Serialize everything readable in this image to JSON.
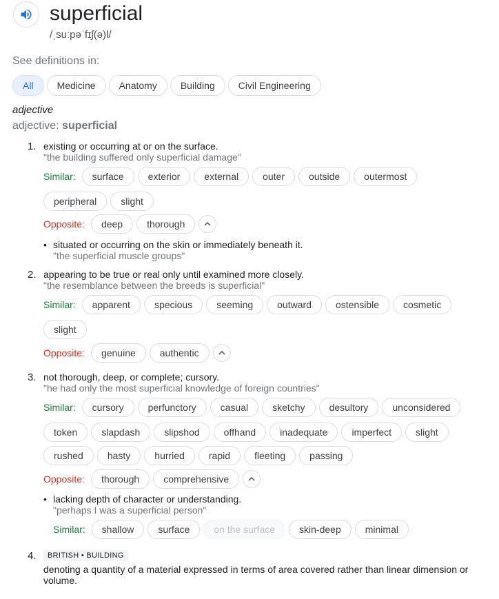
{
  "entry": {
    "word": "superficial",
    "phonetic": "/ˌsuːpəˈfɪʃ(ə)l/"
  },
  "see_definitions": {
    "label": "See definitions in:",
    "tabs": [
      "All",
      "Medicine",
      "Anatomy",
      "Building",
      "Civil Engineering"
    ]
  },
  "pos": {
    "type": "adjective",
    "line_prefix": "adjective: ",
    "line_word": "superficial"
  },
  "labels": {
    "similar": "Similar:",
    "opposite": "Opposite:"
  },
  "senses": [
    {
      "num": "1.",
      "def": "existing or occurring at or on the surface.",
      "example": "\"the building suffered only superficial damage\"",
      "similar_row1": [
        "surface",
        "exterior",
        "external",
        "outer",
        "outside",
        "outermost"
      ],
      "similar_row2": [
        "peripheral",
        "slight"
      ],
      "opposite": [
        "deep",
        "thorough"
      ],
      "sub": {
        "def": "situated or occurring on the skin or immediately beneath it.",
        "example": "\"the superficial muscle groups\""
      }
    },
    {
      "num": "2.",
      "def": "appearing to be true or real only until examined more closely.",
      "example": "\"the resemblance between the breeds is superficial\"",
      "similar_row1": [
        "apparent",
        "specious",
        "seeming",
        "outward",
        "ostensible",
        "cosmetic"
      ],
      "similar_row2": [
        "slight"
      ],
      "opposite": [
        "genuine",
        "authentic"
      ]
    },
    {
      "num": "3.",
      "def": "not thorough, deep, or complete; cursory.",
      "example": "\"he had only the most superficial knowledge of foreign countries\"",
      "similar_row1": [
        "cursory",
        "perfunctory",
        "casual",
        "sketchy",
        "desultory",
        "unconsidered"
      ],
      "similar_row2": [
        "token",
        "slapdash",
        "slipshod",
        "offhand",
        "inadequate",
        "imperfect",
        "slight"
      ],
      "similar_row3": [
        "rushed",
        "hasty",
        "hurried",
        "rapid",
        "fleeting",
        "passing"
      ],
      "opposite": [
        "thorough",
        "comprehensive"
      ],
      "sub": {
        "def": "lacking depth of character or understanding.",
        "example": "\"perhaps I was a superficial person\"",
        "similar": [
          "shallow",
          "surface",
          "on the surface",
          "skin-deep",
          "minimal"
        ]
      }
    },
    {
      "num": "4.",
      "badge": "BRITISH • BUILDING",
      "def_line1": "denoting a quantity of a material expressed in terms of area covered rather than linear dimension or",
      "def_line2": "volume."
    }
  ],
  "colors": {
    "similar": "#188038",
    "opposite": "#d93025",
    "accent": "#1a73e8"
  },
  "icons": {
    "speaker": "speaker-icon",
    "collapse": "chevron-up-icon"
  }
}
